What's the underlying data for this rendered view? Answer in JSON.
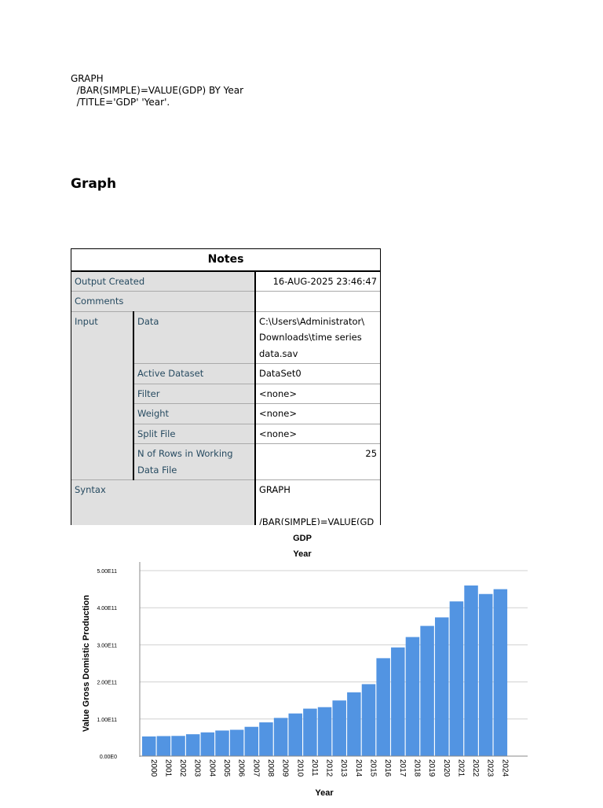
{
  "syntax_block": {
    "lines": [
      "GRAPH",
      "  /BAR(SIMPLE)=VALUE(GDP) BY Year",
      "  /TITLE='GDP' 'Year'."
    ]
  },
  "heading": "Graph",
  "notes": {
    "title": "Notes",
    "output_created_label": "Output Created",
    "output_created_value": "16-AUG-2025 23:46:47",
    "comments_label": "Comments",
    "input_label": "Input",
    "data_label": "Data",
    "data_value": "C:\\Users\\Administrator\\ Downloads\\time series data.sav",
    "active_dataset_label": "Active Dataset",
    "active_dataset_value": "DataSet0",
    "filter_label": "Filter",
    "filter_value": "<none>",
    "weight_label": "Weight",
    "weight_value": "<none>",
    "split_file_label": "Split File",
    "split_file_value": "<none>",
    "n_rows_label": "N of Rows in Working Data File",
    "n_rows_value": "25",
    "syntax_label": "Syntax",
    "syntax_value_1": "GRAPH",
    "syntax_value_2": "/BAR(SIMPLE)=VALUE(GDP) BY Year"
  },
  "chart_data": {
    "type": "bar",
    "title": "GDP",
    "subtitle": "Year",
    "xlabel": "Year",
    "ylabel": "Value Gross Domistic Production",
    "ylim": [
      0,
      500000000000
    ],
    "yticks": [
      0,
      100000000000,
      200000000000,
      300000000000,
      400000000000,
      500000000000
    ],
    "ytick_labels": [
      "0.00E0",
      "1.00E11",
      "2.00E11",
      "3.00E11",
      "4.00E11",
      "5.00E11"
    ],
    "grid": true,
    "bar_color": "#5294e2",
    "categories": [
      "2000",
      "2001",
      "2002",
      "2003",
      "2004",
      "2005",
      "2006",
      "2007",
      "2008",
      "2009",
      "2010",
      "2011",
      "2012",
      "2013",
      "2014",
      "2015",
      "2016",
      "2017",
      "2018",
      "2019",
      "2020",
      "2021",
      "2022",
      "2023",
      "2024"
    ],
    "values": [
      53000000000,
      54000000000,
      54500000000,
      59000000000,
      64000000000,
      69000000000,
      71000000000,
      79000000000,
      91000000000,
      103000000000,
      115000000000,
      128000000000,
      132000000000,
      150000000000,
      172000000000,
      194000000000,
      264000000000,
      293000000000,
      321000000000,
      351000000000,
      374000000000,
      417000000000,
      460000000000,
      437000000000,
      450000000000
    ]
  }
}
